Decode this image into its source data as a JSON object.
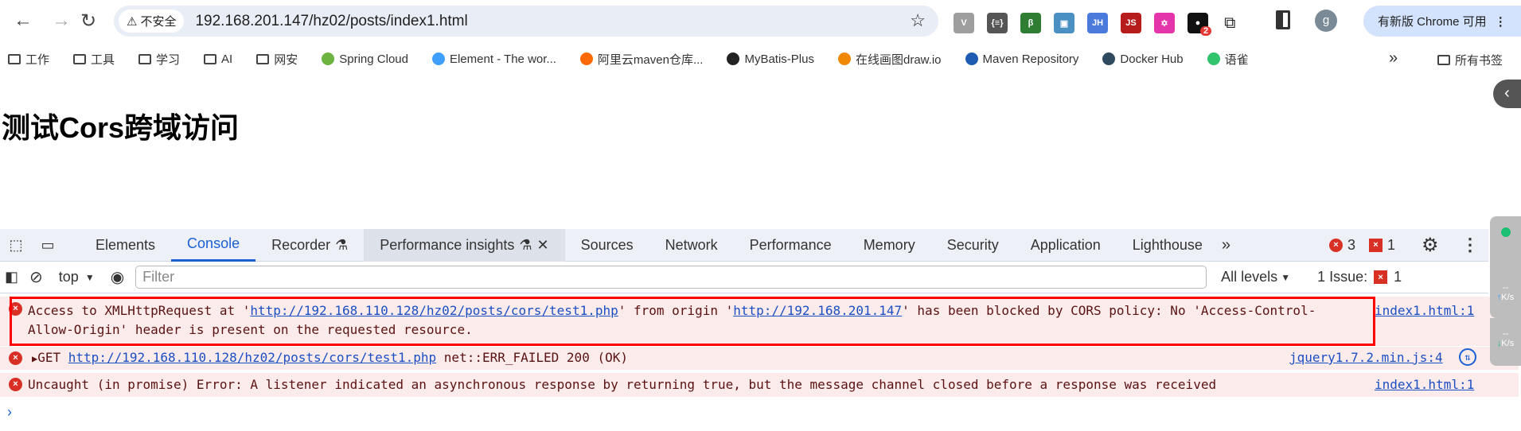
{
  "browser": {
    "url": "192.168.201.147/hz02/posts/index1.html",
    "security_label": "不安全",
    "update_label": "有新版 Chrome 可用",
    "profile_initial": "g",
    "extension_badge": "2",
    "extensions": [
      {
        "name": "vue-devtools",
        "label": "V",
        "color": "#9e9e9e"
      },
      {
        "name": "json-viewer",
        "label": "{≡}",
        "color": "#555"
      },
      {
        "name": "green-ext",
        "label": "β",
        "color": "#2e7d32"
      },
      {
        "name": "image-ext",
        "label": "▣",
        "color": "#4a90c2"
      },
      {
        "name": "jh-ext",
        "label": "JH",
        "color": "#4a7bdc"
      },
      {
        "name": "js-ext",
        "label": "JS",
        "color": "#b71c1c"
      },
      {
        "name": "graphql-ext",
        "label": "✡",
        "color": "#e535ab"
      },
      {
        "name": "black-ext",
        "label": "●",
        "color": "#111"
      }
    ]
  },
  "bookmarks": [
    {
      "label": "工作",
      "icon": "folder"
    },
    {
      "label": "工具",
      "icon": "folder"
    },
    {
      "label": "学习",
      "icon": "folder"
    },
    {
      "label": "AI",
      "icon": "folder"
    },
    {
      "label": "网安",
      "icon": "folder"
    },
    {
      "label": "Spring Cloud",
      "icon": "spring"
    },
    {
      "label": "Element - The wor...",
      "icon": "element"
    },
    {
      "label": "阿里云maven仓库...",
      "icon": "aliyun"
    },
    {
      "label": "MyBatis-Plus",
      "icon": "mybatis"
    },
    {
      "label": "在线画图draw.io",
      "icon": "drawio"
    },
    {
      "label": "Maven Repository",
      "icon": "mvn"
    },
    {
      "label": "Docker Hub",
      "icon": "docker"
    },
    {
      "label": "语雀",
      "icon": "yuque"
    }
  ],
  "all_bookmarks": "所有书签",
  "page": {
    "title": "测试Cors跨域访问"
  },
  "devtools": {
    "tabs": [
      "Elements",
      "Console",
      "Recorder",
      "Performance insights",
      "Sources",
      "Network",
      "Performance",
      "Memory",
      "Security",
      "Application",
      "Lighthouse"
    ],
    "active_tab": "Console",
    "error_count": "3",
    "issue_count": "1",
    "context": "top",
    "filter_placeholder": "Filter",
    "levels": "All levels",
    "issues_label": "1 Issue:",
    "issues_count": "1",
    "messages": [
      {
        "pre": "Access to XMLHttpRequest at '",
        "link1": "http://192.168.110.128/hz02/posts/cors/test1.php",
        "mid": "' from origin '",
        "link2": "http://192.168.201.147",
        "post": "' has been blocked by CORS policy: No 'Access-Control-Allow-Origin' header is present on the requested resource.",
        "source": "index1.html:1"
      },
      {
        "method": "GET",
        "link": "http://192.168.110.128/hz02/posts/cors/test1.php",
        "post": "net::ERR_FAILED 200 (OK)",
        "source": "jquery1.7.2.min.js:4"
      },
      {
        "text": "Uncaught (in promise) Error: A listener indicated an asynchronous response by returning true, but the message channel closed before a response was received",
        "source": "index1.html:1"
      }
    ]
  },
  "speed_widget": {
    "up": "--",
    "up_unit": "K/s",
    "down": "--",
    "down_unit": "K/s"
  },
  "colors": {
    "accent": "#1a5fd4",
    "error": "#d93025",
    "highlight_box": "#ff0000",
    "error_bg": "#fcebeb"
  }
}
